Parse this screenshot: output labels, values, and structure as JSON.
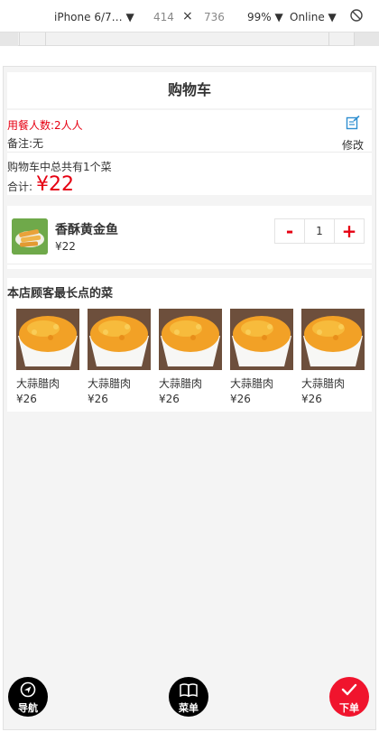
{
  "devtools": {
    "device": "iPhone 6/7…",
    "width": "414",
    "times": "×",
    "height": "736",
    "zoom": "99%",
    "network": "Online"
  },
  "header": {
    "title": "购物车"
  },
  "info": {
    "diners": "用餐人数:2人人",
    "remark": "备注:无",
    "edit_label": "修改",
    "count_text": "购物车中总共有1个菜",
    "total_label": "合计:",
    "total_price": "¥22"
  },
  "cart_item": {
    "name": "香酥黄金鱼",
    "price": "¥22",
    "quantity": "1",
    "minus": "-",
    "plus": "+"
  },
  "recommend": {
    "title": "本店顾客最长点的菜",
    "dishes": [
      {
        "name": "大蒜腊肉",
        "price": "¥26"
      },
      {
        "name": "大蒜腊肉",
        "price": "¥26"
      },
      {
        "name": "大蒜腊肉",
        "price": "¥26"
      },
      {
        "name": "大蒜腊肉",
        "price": "¥26"
      },
      {
        "name": "大蒜腊肉",
        "price": "¥26"
      }
    ]
  },
  "fabs": {
    "nav": "导航",
    "menu": "菜单",
    "order": "下单"
  },
  "colors": {
    "accent": "#e60012",
    "icon_blue": "#2f8fd0"
  }
}
